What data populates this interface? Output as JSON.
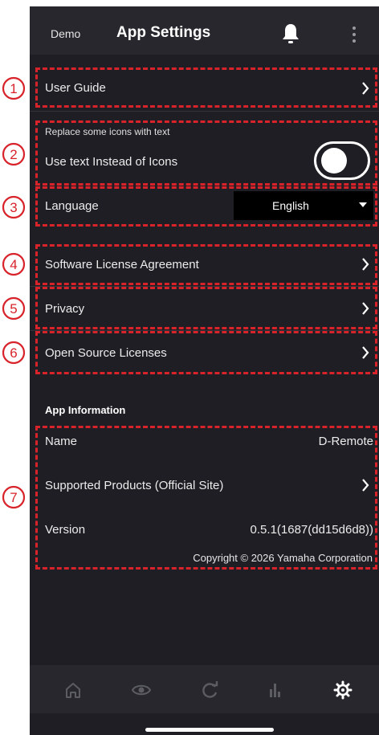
{
  "header": {
    "demo_label": "Demo",
    "title": "App Settings"
  },
  "settings": {
    "user_guide": "User Guide",
    "replace_hint": "Replace some icons with text",
    "use_text_label": "Use text Instead of Icons",
    "use_text_enabled": false,
    "language_label": "Language",
    "language_value": "English",
    "license": "Software License Agreement",
    "privacy": "Privacy",
    "open_source": "Open Source Licenses"
  },
  "app_info": {
    "section_title": "App Information",
    "name_label": "Name",
    "name_value": "D-Remote",
    "supported_label": "Supported Products (Official Site)",
    "version_label": "Version",
    "version_value": "0.5.1(1687(dd15d6d8))",
    "copyright": "Copyright © 2026 Yamaha Corporation"
  },
  "callouts": [
    "1",
    "2",
    "3",
    "4",
    "5",
    "6",
    "7"
  ],
  "tabs": [
    "home-icon",
    "eye-icon",
    "refresh-icon",
    "meter-icon",
    "gear-icon"
  ],
  "colors": {
    "background": "#1e1e24",
    "header": "#27272d",
    "annotation": "#d8232a",
    "active_tab": "#ffffff",
    "inactive_tab": "#5c5c63"
  }
}
